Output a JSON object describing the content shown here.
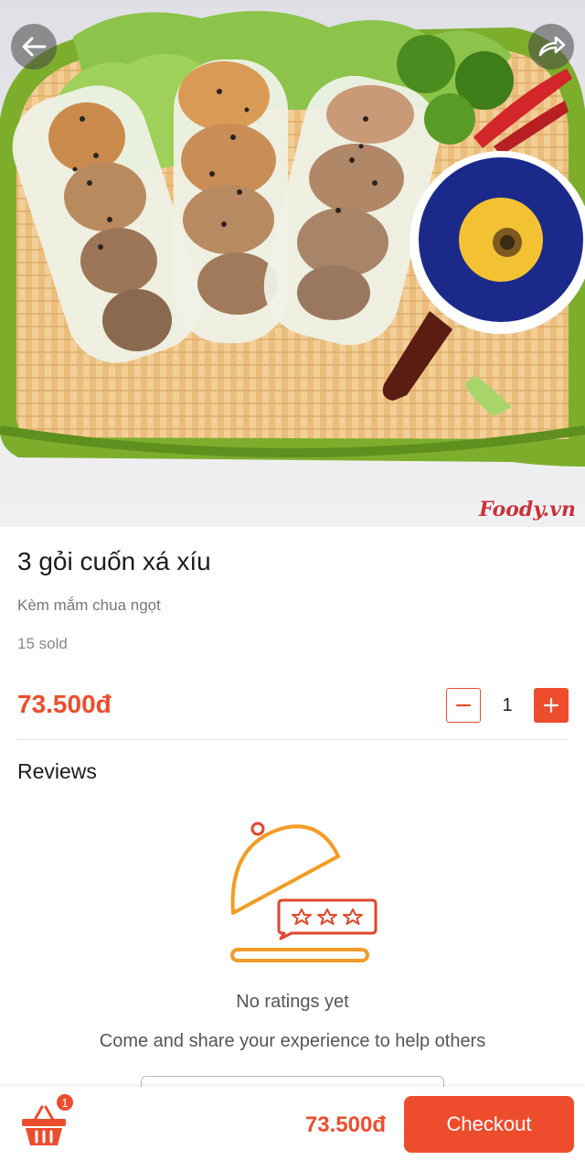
{
  "hero": {
    "watermark": "Foody.vn",
    "back_icon": "arrow-left-icon",
    "share_icon": "share-arrow-icon"
  },
  "product": {
    "title": "3 gỏi cuốn xá xíu",
    "description": "Kèm mắm chua ngọt",
    "sold": "15 sold",
    "price": "73.500đ",
    "quantity": "1",
    "minus_label": "−",
    "plus_label": "+"
  },
  "reviews": {
    "heading": "Reviews",
    "empty_icon": "food-cloche-rating-icon",
    "empty_title": "No ratings yet",
    "empty_message": "Come and share your experience to help others"
  },
  "bottom_bar": {
    "cart_icon": "basket-icon",
    "cart_count": "1",
    "total": "73.500đ",
    "checkout_label": "Checkout"
  },
  "colors": {
    "accent": "#ee4d2d",
    "illustration_orange": "#f39c26"
  }
}
